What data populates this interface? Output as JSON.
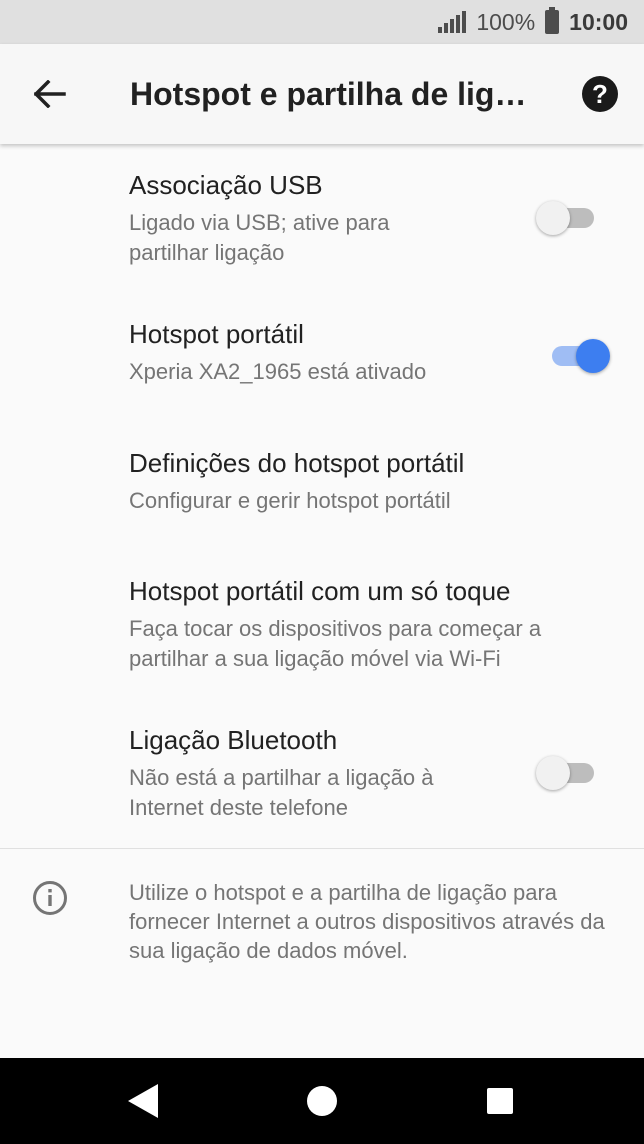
{
  "status_bar": {
    "battery_text": "100%",
    "time": "10:00"
  },
  "app_bar": {
    "title": "Hotspot e partilha de ligação",
    "back_icon": "arrow-left-icon",
    "help_icon": "help-circle-icon",
    "help_glyph": "?"
  },
  "items": [
    {
      "title": "Associação USB",
      "subtitle": "Ligado via USB; ative para partilhar ligação",
      "toggle": "off"
    },
    {
      "title": "Hotspot portátil",
      "subtitle": "Xperia XA2_1965 está ativado",
      "toggle": "on"
    },
    {
      "title": "Definições do hotspot portátil",
      "subtitle": "Configurar e gerir hotspot portátil"
    },
    {
      "title": "Hotspot portátil com um só toque",
      "subtitle": "Faça tocar os dispositivos para começar a partilhar a sua ligação móvel via Wi-Fi"
    },
    {
      "title": "Ligação Bluetooth",
      "subtitle": "Não está a partilhar a ligação à Internet deste telefone",
      "toggle": "off"
    }
  ],
  "info": {
    "icon": "info-icon",
    "text": "Utilize o hotspot e a partilha de ligação para fornecer Internet a outros dispositivos através da sua ligação de dados móvel."
  },
  "colors": {
    "accent": "#3d7ef0",
    "accent_track": "#9fbdf4",
    "status_bar_bg": "#e0e0e0",
    "nav_bar_bg": "#000000"
  }
}
